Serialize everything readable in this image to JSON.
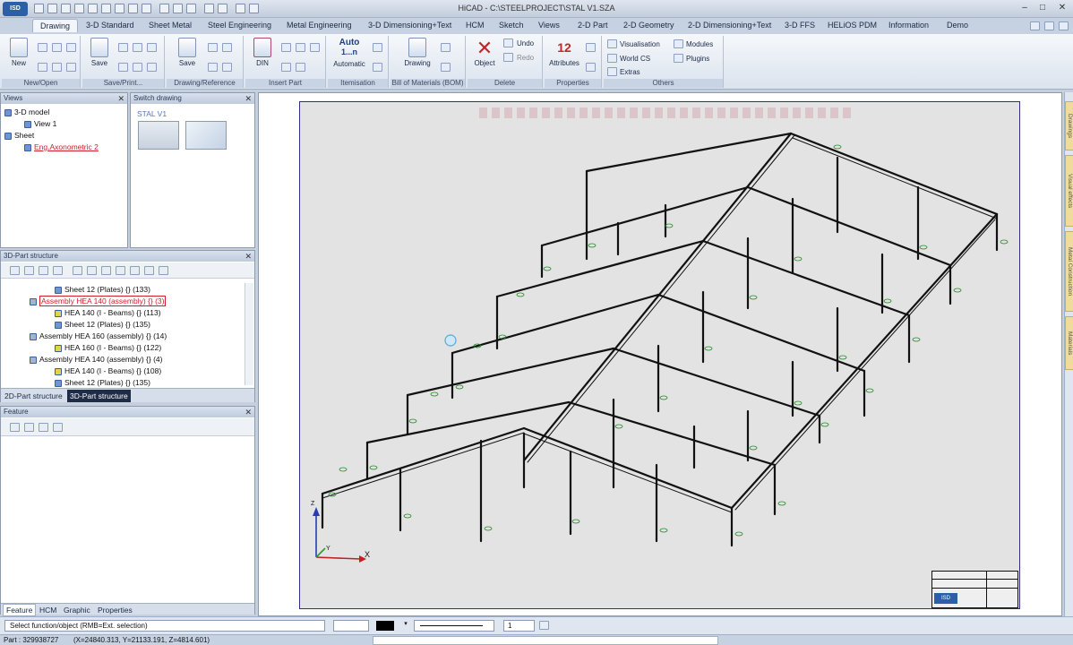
{
  "app": {
    "title": "HiCAD - C:\\STEELPROJECT\\STAL V1.SZA",
    "logo": "ISD",
    "window_controls": [
      "–",
      "□",
      "✕"
    ]
  },
  "ribbon_tabs": [
    "Drawing",
    "3-D Standard",
    "Sheet Metal",
    "Steel Engineering",
    "Metal Engineering",
    "3-D Dimensioning+Text",
    "HCM",
    "Sketch",
    "Views",
    "2-D Part",
    "2-D Geometry",
    "2-D Dimensioning+Text",
    "3-D FFS",
    "HELiOS PDM",
    "Information",
    "Demo"
  ],
  "ribbon": {
    "groups": [
      "New/Open",
      "Save/Print...",
      "Drawing/Reference",
      "Insert Part",
      "Itemisation",
      "Bill of Materials (BOM)",
      "Delete",
      "Properties",
      "Others"
    ],
    "buttons": {
      "new": "New",
      "save": "Save",
      "save2": "Save",
      "din": "DIN",
      "automatic_top": "Auto",
      "automatic_mid": "1...n",
      "automatic": "Automatic",
      "drawing": "Drawing",
      "object": "Object",
      "undo": "Undo",
      "redo": "Redo",
      "attributes": "Attributes",
      "visualisation": "Visualisation",
      "modules": "Modules",
      "world_cs": "World CS",
      "plugins": "Plugins",
      "extras": "Extras"
    }
  },
  "views_panel": {
    "title": "Views",
    "items": [
      "3-D model",
      "View 1",
      "Sheet",
      "Eng.Axonometric 2"
    ]
  },
  "switch_panel": {
    "title": "Switch drawing",
    "label": "STAL V1"
  },
  "structure_panel": {
    "title": "3D-Part structure",
    "rows": [
      "Sheet 12 (Plates) {} (133)",
      "Assembly HEA 140 (assembly) {} (3)",
      "HEA 140 (I - Beams) {} (113)",
      "Sheet 12 (Plates) {} (135)",
      "Assembly HEA 160 (assembly) {} (14)",
      "HEA 160 (I - Beams) {} (122)",
      "Assembly HEA 140 (assembly) {} (4)",
      "HEA 140 (I - Beams) {} (108)",
      "Sheet 12 (Plates) {} (135)"
    ],
    "tabs": [
      "2D-Part structure",
      "3D-Part structure"
    ]
  },
  "feature_panel": {
    "title": "Feature",
    "tabs": [
      "Feature",
      "HCM",
      "Graphic",
      "Properties"
    ]
  },
  "right_tabs": [
    "Drawings",
    "Visual effects",
    "Metal Construction",
    "Materials"
  ],
  "status": {
    "prompt": "Select function/object (RMB=Ext. selection)",
    "line_value": "1",
    "part": "Part : 329938727",
    "coords": "(X=24840.313, Y=21133.191, Z=4814.601)"
  },
  "axes": {
    "x": "X",
    "y": "Y",
    "z": "Z"
  }
}
